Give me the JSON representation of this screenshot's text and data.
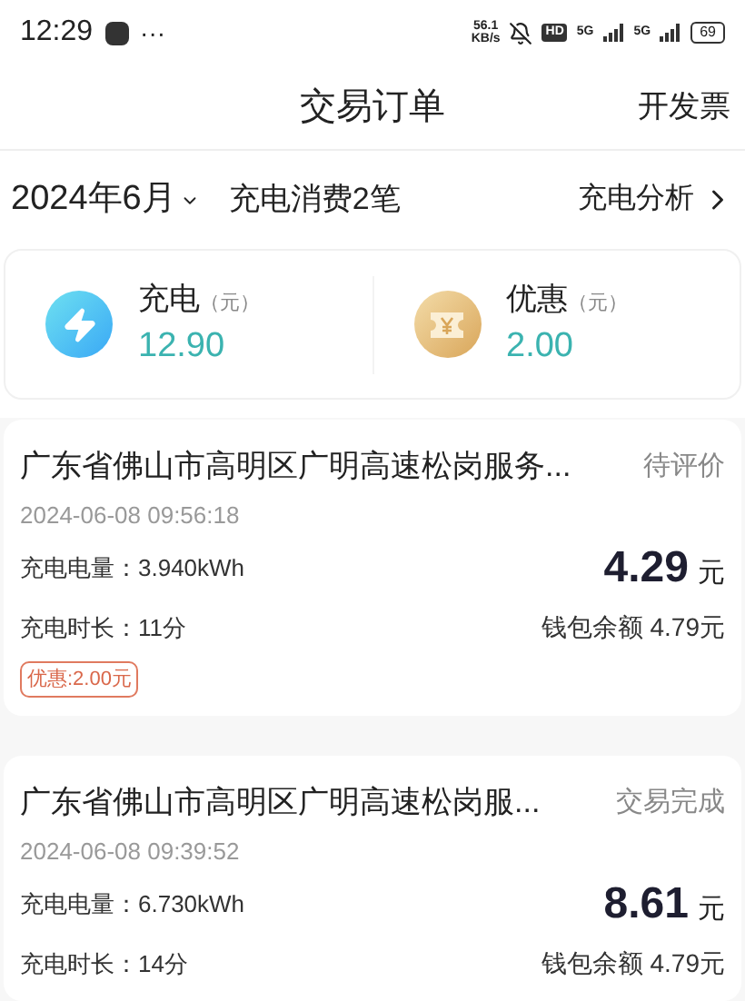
{
  "status_bar": {
    "time": "12:29",
    "dots": "···",
    "speed_value": "56.1",
    "speed_unit": "KB/s",
    "hd": "HD",
    "network_1": "5G",
    "network_2": "5G",
    "battery": "69"
  },
  "header": {
    "title": "交易订单",
    "action": "开发票"
  },
  "filter": {
    "month": "2024年6月",
    "summary": "充电消费2笔",
    "analysis": "充电分析"
  },
  "totals": [
    {
      "kind": "charge",
      "label": "充电",
      "unit": "（元）",
      "value": "12.90"
    },
    {
      "kind": "discount",
      "label": "优惠",
      "unit": "（元）",
      "value": "2.00"
    }
  ],
  "orders": [
    {
      "station": "广东省佛山市高明区广明高速松岗服务...",
      "status": "待评价",
      "time": "2024-06-08 09:56:18",
      "energy_label": "充电电量：",
      "energy": "3.940kWh",
      "duration_label": "充电时长：",
      "duration": "11分",
      "amount": "4.29",
      "currency": "元",
      "wallet": "钱包余额 4.79元",
      "discount": "优惠:2.00元"
    },
    {
      "station": "广东省佛山市高明区广明高速松岗服...",
      "status": "交易完成",
      "time": "2024-06-08 09:39:52",
      "energy_label": "充电电量：",
      "energy": "6.730kWh",
      "duration_label": "充电时长：",
      "duration": "14分",
      "amount": "8.61",
      "currency": "元",
      "wallet": "钱包余额 4.79元"
    }
  ]
}
